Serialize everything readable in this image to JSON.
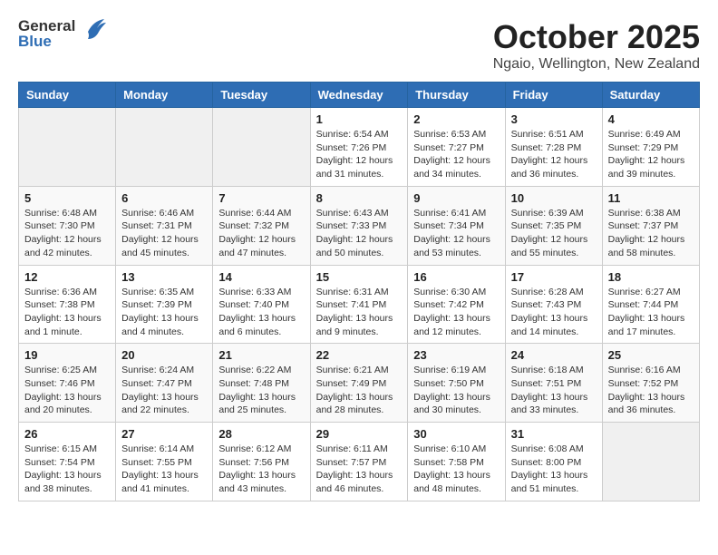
{
  "header": {
    "logo_general": "General",
    "logo_blue": "Blue",
    "month_title": "October 2025",
    "location": "Ngaio, Wellington, New Zealand"
  },
  "days_of_week": [
    "Sunday",
    "Monday",
    "Tuesday",
    "Wednesday",
    "Thursday",
    "Friday",
    "Saturday"
  ],
  "weeks": [
    [
      {
        "day": "",
        "info": ""
      },
      {
        "day": "",
        "info": ""
      },
      {
        "day": "",
        "info": ""
      },
      {
        "day": "1",
        "info": "Sunrise: 6:54 AM\nSunset: 7:26 PM\nDaylight: 12 hours\nand 31 minutes."
      },
      {
        "day": "2",
        "info": "Sunrise: 6:53 AM\nSunset: 7:27 PM\nDaylight: 12 hours\nand 34 minutes."
      },
      {
        "day": "3",
        "info": "Sunrise: 6:51 AM\nSunset: 7:28 PM\nDaylight: 12 hours\nand 36 minutes."
      },
      {
        "day": "4",
        "info": "Sunrise: 6:49 AM\nSunset: 7:29 PM\nDaylight: 12 hours\nand 39 minutes."
      }
    ],
    [
      {
        "day": "5",
        "info": "Sunrise: 6:48 AM\nSunset: 7:30 PM\nDaylight: 12 hours\nand 42 minutes."
      },
      {
        "day": "6",
        "info": "Sunrise: 6:46 AM\nSunset: 7:31 PM\nDaylight: 12 hours\nand 45 minutes."
      },
      {
        "day": "7",
        "info": "Sunrise: 6:44 AM\nSunset: 7:32 PM\nDaylight: 12 hours\nand 47 minutes."
      },
      {
        "day": "8",
        "info": "Sunrise: 6:43 AM\nSunset: 7:33 PM\nDaylight: 12 hours\nand 50 minutes."
      },
      {
        "day": "9",
        "info": "Sunrise: 6:41 AM\nSunset: 7:34 PM\nDaylight: 12 hours\nand 53 minutes."
      },
      {
        "day": "10",
        "info": "Sunrise: 6:39 AM\nSunset: 7:35 PM\nDaylight: 12 hours\nand 55 minutes."
      },
      {
        "day": "11",
        "info": "Sunrise: 6:38 AM\nSunset: 7:37 PM\nDaylight: 12 hours\nand 58 minutes."
      }
    ],
    [
      {
        "day": "12",
        "info": "Sunrise: 6:36 AM\nSunset: 7:38 PM\nDaylight: 13 hours\nand 1 minute."
      },
      {
        "day": "13",
        "info": "Sunrise: 6:35 AM\nSunset: 7:39 PM\nDaylight: 13 hours\nand 4 minutes."
      },
      {
        "day": "14",
        "info": "Sunrise: 6:33 AM\nSunset: 7:40 PM\nDaylight: 13 hours\nand 6 minutes."
      },
      {
        "day": "15",
        "info": "Sunrise: 6:31 AM\nSunset: 7:41 PM\nDaylight: 13 hours\nand 9 minutes."
      },
      {
        "day": "16",
        "info": "Sunrise: 6:30 AM\nSunset: 7:42 PM\nDaylight: 13 hours\nand 12 minutes."
      },
      {
        "day": "17",
        "info": "Sunrise: 6:28 AM\nSunset: 7:43 PM\nDaylight: 13 hours\nand 14 minutes."
      },
      {
        "day": "18",
        "info": "Sunrise: 6:27 AM\nSunset: 7:44 PM\nDaylight: 13 hours\nand 17 minutes."
      }
    ],
    [
      {
        "day": "19",
        "info": "Sunrise: 6:25 AM\nSunset: 7:46 PM\nDaylight: 13 hours\nand 20 minutes."
      },
      {
        "day": "20",
        "info": "Sunrise: 6:24 AM\nSunset: 7:47 PM\nDaylight: 13 hours\nand 22 minutes."
      },
      {
        "day": "21",
        "info": "Sunrise: 6:22 AM\nSunset: 7:48 PM\nDaylight: 13 hours\nand 25 minutes."
      },
      {
        "day": "22",
        "info": "Sunrise: 6:21 AM\nSunset: 7:49 PM\nDaylight: 13 hours\nand 28 minutes."
      },
      {
        "day": "23",
        "info": "Sunrise: 6:19 AM\nSunset: 7:50 PM\nDaylight: 13 hours\nand 30 minutes."
      },
      {
        "day": "24",
        "info": "Sunrise: 6:18 AM\nSunset: 7:51 PM\nDaylight: 13 hours\nand 33 minutes."
      },
      {
        "day": "25",
        "info": "Sunrise: 6:16 AM\nSunset: 7:52 PM\nDaylight: 13 hours\nand 36 minutes."
      }
    ],
    [
      {
        "day": "26",
        "info": "Sunrise: 6:15 AM\nSunset: 7:54 PM\nDaylight: 13 hours\nand 38 minutes."
      },
      {
        "day": "27",
        "info": "Sunrise: 6:14 AM\nSunset: 7:55 PM\nDaylight: 13 hours\nand 41 minutes."
      },
      {
        "day": "28",
        "info": "Sunrise: 6:12 AM\nSunset: 7:56 PM\nDaylight: 13 hours\nand 43 minutes."
      },
      {
        "day": "29",
        "info": "Sunrise: 6:11 AM\nSunset: 7:57 PM\nDaylight: 13 hours\nand 46 minutes."
      },
      {
        "day": "30",
        "info": "Sunrise: 6:10 AM\nSunset: 7:58 PM\nDaylight: 13 hours\nand 48 minutes."
      },
      {
        "day": "31",
        "info": "Sunrise: 6:08 AM\nSunset: 8:00 PM\nDaylight: 13 hours\nand 51 minutes."
      },
      {
        "day": "",
        "info": ""
      }
    ]
  ]
}
